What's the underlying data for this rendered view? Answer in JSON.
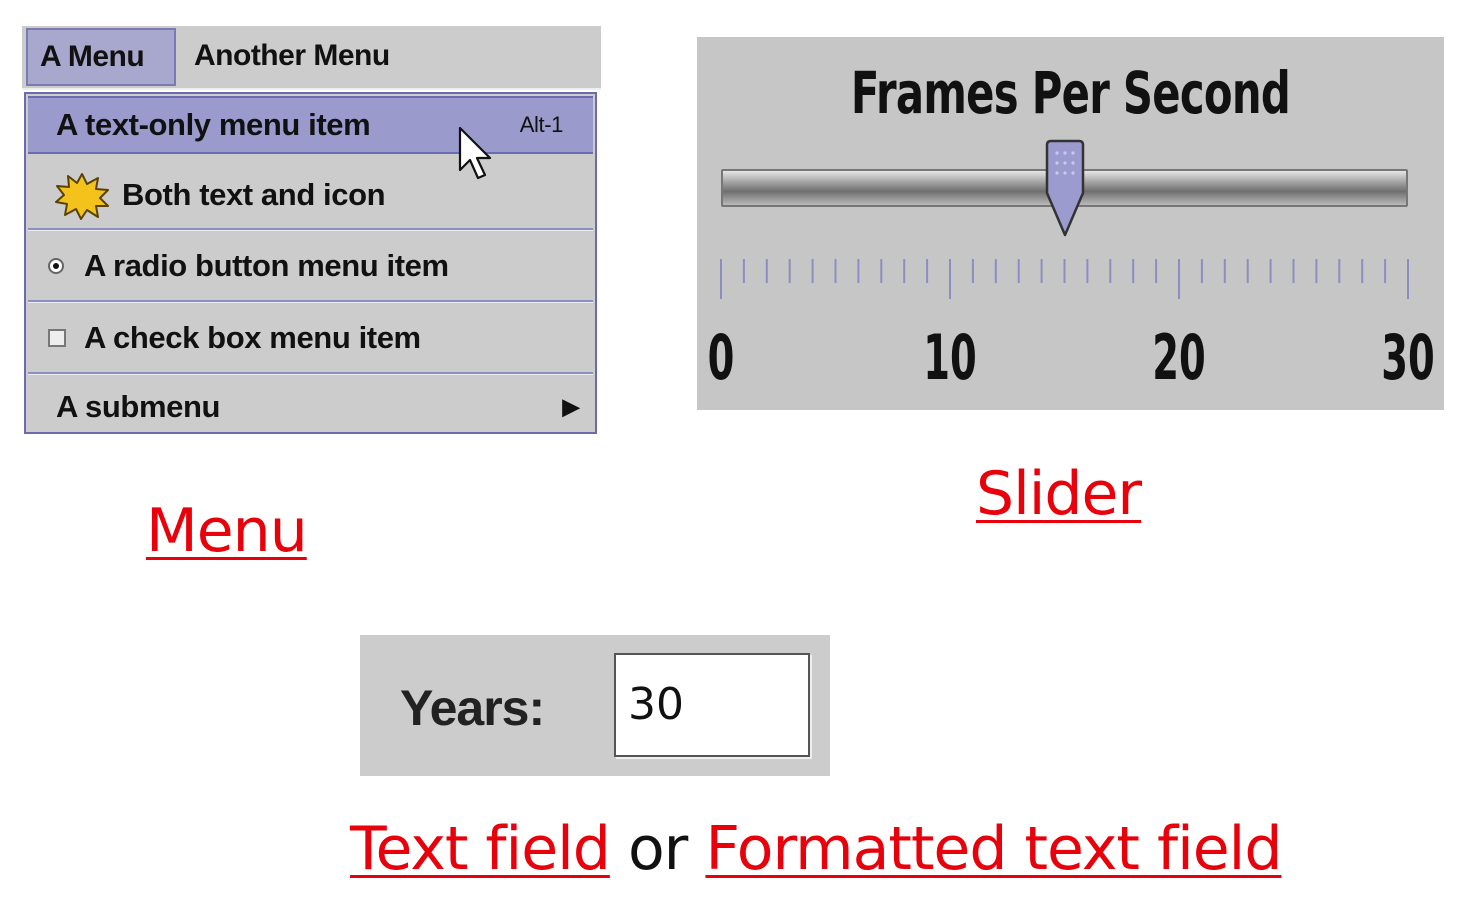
{
  "menu_panel": {
    "menubar": [
      "A Menu",
      "Another Menu"
    ],
    "items": [
      {
        "label": "A text-only menu item",
        "accelerator": "Alt-1",
        "highlighted": true
      },
      {
        "label": "Both text and icon",
        "icon": "starburst-icon"
      },
      {
        "label": "A radio button menu item",
        "type": "radio",
        "selected": true
      },
      {
        "label": "A check box menu item",
        "type": "checkbox",
        "checked": false
      },
      {
        "label": "A submenu",
        "type": "submenu",
        "icon": "submenu-arrow-icon"
      }
    ],
    "cursor_icon": "mouse-pointer-icon"
  },
  "slider_panel": {
    "title": "Frames Per Second",
    "min": 0,
    "max": 30,
    "value": 15,
    "major_tick_spacing": 10,
    "minor_tick_spacing": 1,
    "labels": [
      "0",
      "10",
      "20",
      "30"
    ]
  },
  "textfield_panel": {
    "label": "Years:",
    "value": "30"
  },
  "captions": {
    "menu": "Menu",
    "slider": "Slider",
    "text_field": "Text field",
    "or": "or",
    "formatted_text_field": "Formatted text field"
  },
  "colors": {
    "caption_red": "#e8000a",
    "panel_gray": "#cccccc",
    "menu_highlight": "#9a9acc",
    "menu_border": "#6b6bb0",
    "slider_thumb": "#9b9bd0"
  }
}
